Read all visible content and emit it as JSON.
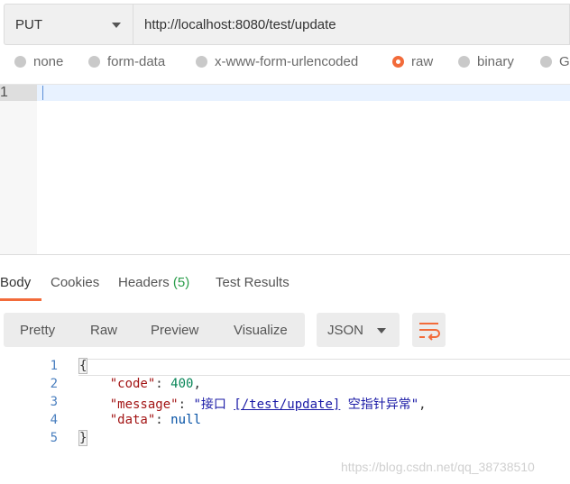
{
  "request": {
    "method": "PUT",
    "url": "http://localhost:8080/test/update"
  },
  "body_types": [
    {
      "label": "none",
      "selected": false
    },
    {
      "label": "form-data",
      "selected": false
    },
    {
      "label": "x-www-form-urlencoded",
      "selected": false
    },
    {
      "label": "raw",
      "selected": true
    },
    {
      "label": "binary",
      "selected": false
    },
    {
      "label": "G",
      "selected": false
    }
  ],
  "editor": {
    "line_numbers": [
      "1"
    ]
  },
  "response_tabs": {
    "body": "Body",
    "cookies": "Cookies",
    "headers": "Headers",
    "headers_count": "(5)",
    "test_results": "Test Results"
  },
  "view_modes": {
    "pretty": "Pretty",
    "raw": "Raw",
    "preview": "Preview",
    "visualize": "Visualize"
  },
  "format": {
    "selected": "JSON"
  },
  "response_lines": {
    "numbers": [
      "1",
      "2",
      "3",
      "4",
      "5"
    ],
    "open": "{",
    "code_key": "\"code\"",
    "code_value": "400",
    "message_key": "\"message\"",
    "message_prefix": "\"接口 ",
    "message_link": "[/test/update]",
    "message_suffix": " 空指针异常\"",
    "data_key": "\"data\"",
    "data_value": "null",
    "close": "}"
  },
  "colors": {
    "accent": "#f26b3a",
    "count_green": "#2a9d4a"
  },
  "icons": {
    "wrap": "wrap-lines-icon",
    "caret": "chevron-down-icon"
  },
  "watermark": "https://blog.csdn.net/qq_38738510"
}
